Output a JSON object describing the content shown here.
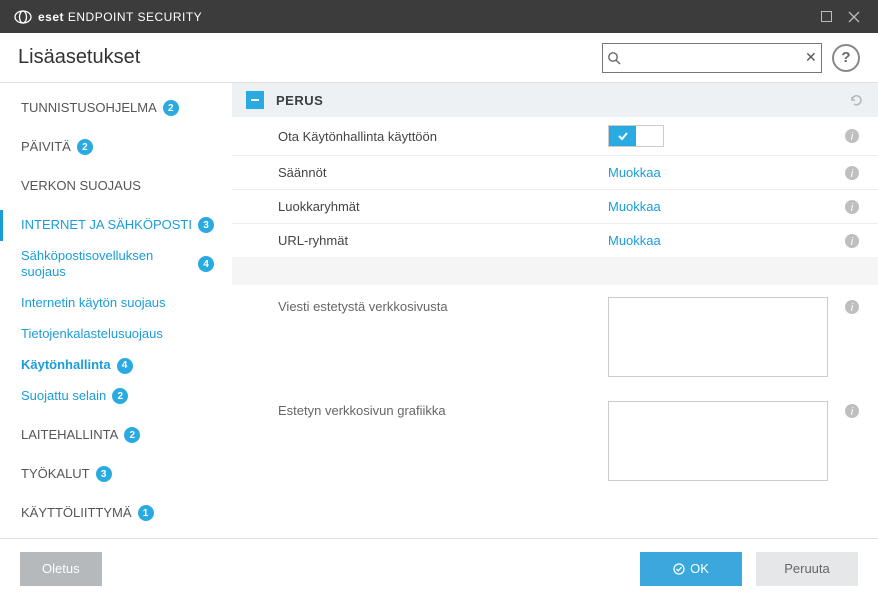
{
  "app": {
    "brand_bold": "eset",
    "brand_rest": "ENDPOINT SECURITY"
  },
  "header": {
    "title": "Lisäasetukset",
    "search_value": "",
    "clear_glyph": "✕",
    "help_glyph": "?"
  },
  "sidebar": {
    "items": [
      {
        "label": "TUNNISTUSOHJELMA",
        "badge": "2"
      },
      {
        "label": "PÄIVITÄ",
        "badge": "2"
      },
      {
        "label": "VERKON SUOJAUS",
        "badge": ""
      },
      {
        "label": "INTERNET JA SÄHKÖPOSTI",
        "badge": "3"
      }
    ],
    "subs": [
      {
        "label": "Sähköpostisovelluksen suojaus",
        "badge": "4"
      },
      {
        "label": "Internetin käytön suojaus",
        "badge": ""
      },
      {
        "label": "Tietojenkalastelusuojaus",
        "badge": ""
      },
      {
        "label": "Käytönhallinta",
        "badge": "4"
      },
      {
        "label": "Suojattu selain",
        "badge": "2"
      }
    ],
    "items2": [
      {
        "label": "LAITEHALLINTA",
        "badge": "2"
      },
      {
        "label": "TYÖKALUT",
        "badge": "3"
      },
      {
        "label": "KÄYTTÖLIITTYMÄ",
        "badge": "1"
      }
    ]
  },
  "section": {
    "title": "PERUS",
    "rows": {
      "enable": "Ota Käytönhallinta käyttöön",
      "rules": "Säännöt",
      "catgroups": "Luokkaryhmät",
      "urlgroups": "URL-ryhmät",
      "edit": "Muokkaa",
      "msg": "Viesti estetystä verkkosivusta",
      "gfx": "Estetyn verkkosivun grafiikka"
    }
  },
  "footer": {
    "default": "Oletus",
    "ok": "OK",
    "cancel": "Peruuta"
  }
}
